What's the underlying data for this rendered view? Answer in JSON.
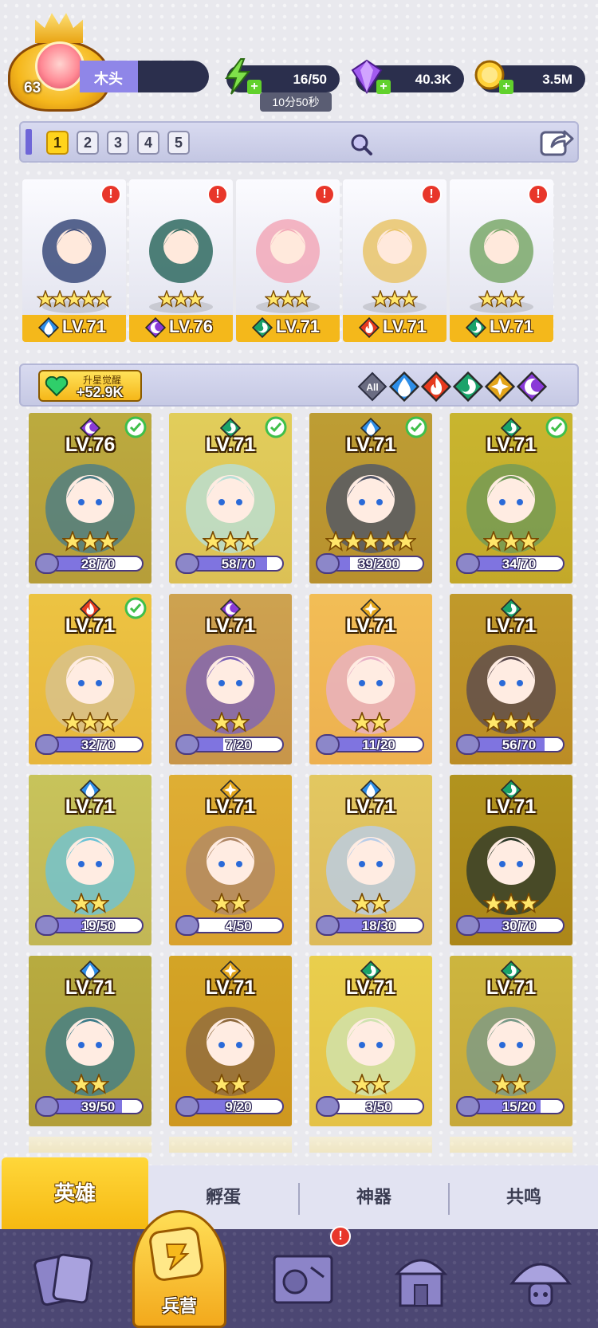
{
  "player": {
    "level": "63",
    "name": "木头",
    "xp_fraction": 0.45
  },
  "resources": {
    "energy": {
      "value": "16/50",
      "timer": "10分50秒",
      "icon": "lightning-icon"
    },
    "gems": {
      "value": "40.3K",
      "icon": "gem-icon"
    },
    "gold": {
      "value": "3.5M",
      "icon": "coin-icon"
    }
  },
  "team_tabs": [
    "1",
    "2",
    "3",
    "4",
    "5"
  ],
  "team_active": 0,
  "team": [
    {
      "level": "LV.71",
      "stars": 5,
      "element": "water",
      "alert": "!",
      "theme": "#3a4a7a"
    },
    {
      "level": "LV.76",
      "stars": 3,
      "element": "dark",
      "alert": "!",
      "theme": "#2f6a60"
    },
    {
      "level": "LV.71",
      "stars": 3,
      "element": "nature",
      "alert": "!",
      "theme": "#f2a8b8"
    },
    {
      "level": "LV.71",
      "stars": 3,
      "element": "fire",
      "alert": "!",
      "theme": "#e9c46a"
    },
    {
      "level": "LV.71",
      "stars": 3,
      "element": "nature",
      "alert": "!",
      "theme": "#7aa86a"
    }
  ],
  "awaken": {
    "label": "升星觉醒",
    "value": "+52.9K"
  },
  "filters": [
    {
      "name": "all",
      "label": "All"
    },
    {
      "name": "water"
    },
    {
      "name": "fire"
    },
    {
      "name": "nature"
    },
    {
      "name": "light"
    },
    {
      "name": "dark"
    }
  ],
  "roster": [
    {
      "level": "LV.76",
      "element": "dark",
      "checked": true,
      "stars": 3,
      "shards": "28/70",
      "fill": 0.4,
      "theme": "#4a7c86"
    },
    {
      "level": "LV.71",
      "element": "nature",
      "checked": true,
      "stars": 3,
      "shards": "58/70",
      "fill": 0.83,
      "theme": "#b8e0d8"
    },
    {
      "level": "LV.71",
      "element": "water",
      "checked": true,
      "stars": 5,
      "shards": "39/200",
      "fill": 0.2,
      "theme": "#4f5568"
    },
    {
      "level": "LV.71",
      "element": "nature",
      "checked": true,
      "stars": 3,
      "shards": "34/70",
      "fill": 0.49,
      "theme": "#6f9a58"
    },
    {
      "level": "LV.71",
      "element": "fire",
      "checked": true,
      "stars": 3,
      "shards": "32/70",
      "fill": 0.46,
      "theme": "#d7c290"
    },
    {
      "level": "LV.71",
      "element": "dark",
      "checked": false,
      "stars": 2,
      "shards": "7/20",
      "fill": 0.35,
      "theme": "#7d63b8"
    },
    {
      "level": "LV.71",
      "element": "light",
      "checked": false,
      "stars": 2,
      "shards": "11/20",
      "fill": 0.55,
      "theme": "#e8b2c8"
    },
    {
      "level": "LV.71",
      "element": "nature",
      "checked": false,
      "stars": 3,
      "shards": "56/70",
      "fill": 0.8,
      "theme": "#5a4a4e"
    },
    {
      "level": "LV.71",
      "element": "water",
      "checked": false,
      "stars": 2,
      "shards": "19/50",
      "fill": 0.38,
      "theme": "#6ec3d6"
    },
    {
      "level": "LV.71",
      "element": "light",
      "checked": false,
      "stars": 2,
      "shards": "4/50",
      "fill": 0.08,
      "theme": "#b08868"
    },
    {
      "level": "LV.71",
      "element": "water",
      "checked": false,
      "stars": 2,
      "shards": "18/30",
      "fill": 0.6,
      "theme": "#b9cde8"
    },
    {
      "level": "LV.71",
      "element": "nature",
      "checked": false,
      "stars": 3,
      "shards": "30/70",
      "fill": 0.43,
      "theme": "#2e3a2a"
    },
    {
      "level": "LV.71",
      "element": "water",
      "checked": false,
      "stars": 2,
      "shards": "39/50",
      "fill": 0.78,
      "theme": "#3f7d8a"
    },
    {
      "level": "LV.71",
      "element": "light",
      "checked": false,
      "stars": 2,
      "shards": "9/20",
      "fill": 0.45,
      "theme": "#8f6a3e"
    },
    {
      "level": "LV.71",
      "element": "nature",
      "checked": false,
      "stars": 2,
      "shards": "3/50",
      "fill": 0.06,
      "theme": "#cfe3b0"
    },
    {
      "level": "LV.71",
      "element": "nature",
      "checked": false,
      "stars": 2,
      "shards": "15/20",
      "fill": 0.75,
      "theme": "#7a9a88"
    }
  ],
  "subtabs": [
    "英雄",
    "孵蛋",
    "神器",
    "共鸣"
  ],
  "nav": {
    "items": [
      "cards-icon",
      "barracks-icon",
      "map-icon",
      "temple-icon",
      "mushroom-icon"
    ],
    "barracks_label": "兵营",
    "map_alert": "!"
  },
  "colors": {
    "water": "#2d8ee8",
    "fire": "#e63a1e",
    "nature": "#1aa36a",
    "light": "#e3a51a",
    "dark": "#8a3ad8",
    "gold": "#f4b81b",
    "accent": "#6f66d8"
  }
}
